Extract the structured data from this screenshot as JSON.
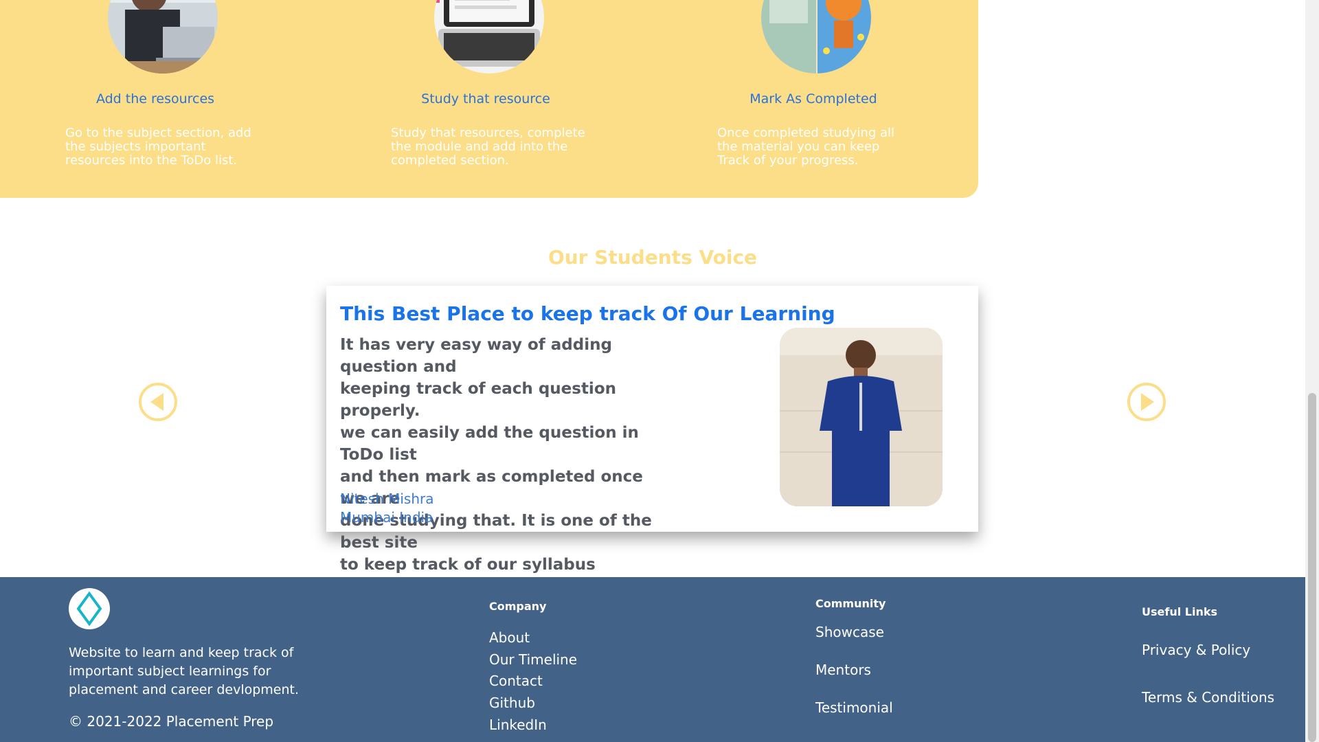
{
  "steps": [
    {
      "icon": "person-with-laptop-photo",
      "title": "Add the resources",
      "lines": [
        "Go to the subject section, add",
        "the subjects important",
        "resources into the ToDo list."
      ]
    },
    {
      "icon": "laptop-photo",
      "title": "Study that resource",
      "lines": [
        "Study that resources, complete",
        "the module and add into the",
        "completed section."
      ]
    },
    {
      "icon": "books-photo",
      "title": "Mark As Completed",
      "lines": [
        "Once completed studying all",
        "the material you can keep",
        "Track of your progress."
      ]
    }
  ],
  "voice": {
    "title": "Our Students Voice",
    "testimonial": {
      "heading": "This Best Place to keep track Of Our Learning",
      "body_lines": [
        "It has very easy way of adding question and",
        "keeping track of each question properly.",
        "we can easily add the question in ToDo list",
        "and then mark as completed once we are",
        "done studying that. It is one of the best site",
        "to keep track of our syllabus completion."
      ],
      "name": "Nitesh Mishra",
      "location": "Mumbai India"
    },
    "prev_icon": "arrow-left-circle-icon",
    "next_icon": "arrow-right-circle-icon"
  },
  "footer": {
    "description_lines": [
      "Website to learn and keep track of",
      "important subject learnings for",
      "placement and career devlopment."
    ],
    "copyright": "© 2021-2022 Placement Prep",
    "company": {
      "heading": "Company",
      "links": [
        "About",
        "Our Timeline",
        "Contact",
        "Github",
        "LinkedIn"
      ]
    },
    "community": {
      "heading": "Community",
      "links": [
        "Showcase",
        "Mentors",
        "Testimonial"
      ]
    },
    "useful": {
      "heading": "Useful Links",
      "links": [
        "Privacy & Policy",
        "Terms & Conditions"
      ]
    }
  },
  "colors": {
    "accent_yellow": "#fcdd88",
    "link_blue": "#1a73e8",
    "footer_bg": "#436288"
  }
}
